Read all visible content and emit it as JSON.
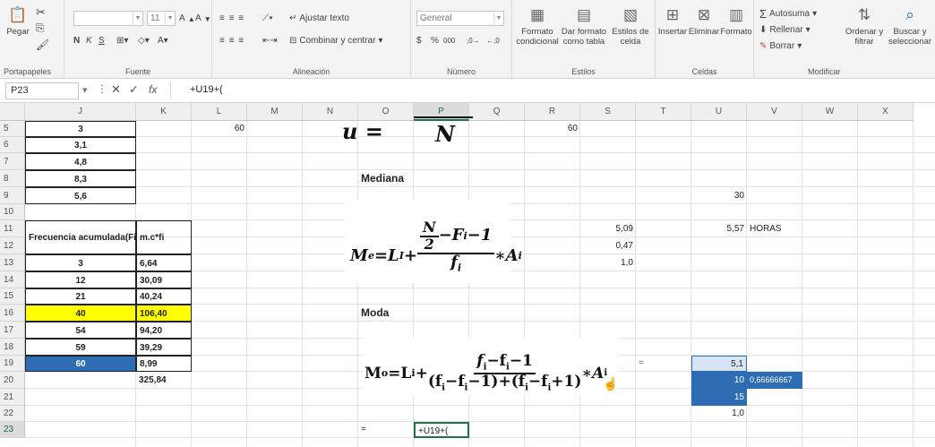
{
  "ribbon": {
    "clipboard": {
      "paste": "Pegar",
      "label": "Portapapeles"
    },
    "font": {
      "size": "11",
      "bold": "N",
      "italic": "K",
      "underline": "S",
      "label": "Fuente"
    },
    "alignment": {
      "wrap": "Ajustar texto",
      "merge": "Combinar y centrar",
      "label": "Alineación"
    },
    "number": {
      "format": "General",
      "currency": "$",
      "percent": "%",
      "thousands": "000",
      "label": "Número"
    },
    "styles": {
      "conditional_1": "Formato",
      "conditional_2": "condicional",
      "table_1": "Dar formato",
      "table_2": "como tabla",
      "cell_styles_1": "Estilos de",
      "cell_styles_2": "celda",
      "label": "Estilos"
    },
    "cells": {
      "insert": "Insertar",
      "delete": "Eliminar",
      "format": "Formato",
      "label": "Celdas"
    },
    "editing": {
      "autosum": "Autosuma",
      "fill": "Rellenar",
      "clear": "Borrar",
      "sort_1": "Ordenar y",
      "sort_2": "filtrar",
      "find_1": "Buscar y",
      "find_2": "seleccionar",
      "label": "Modificar"
    }
  },
  "formula_bar": {
    "name_box": "P23",
    "fx": "fx",
    "content": "+U19+("
  },
  "columns": [
    "J",
    "K",
    "L",
    "M",
    "N",
    "O",
    "P",
    "Q",
    "R",
    "S",
    "T",
    "U",
    "V",
    "W",
    "X"
  ],
  "rows": [
    "5",
    "6",
    "7",
    "8",
    "9",
    "10",
    "11",
    "12",
    "13",
    "14",
    "15",
    "16",
    "17",
    "18",
    "19",
    "20",
    "21",
    "22",
    "23"
  ],
  "cells": {
    "J5": "3",
    "J6": "3,1",
    "J7": "4,8",
    "J8": "8,3",
    "J9": "5,6",
    "J11": "Frecuencia acumulada(Fi)",
    "K11": "m.c*fi",
    "J13": "3",
    "K13": "6,64",
    "J14": "12",
    "K14": "30,09",
    "J15": "21",
    "K15": "40,24",
    "J16": "40",
    "K16": "106,40",
    "J17": "54",
    "K17": "94,20",
    "J18": "59",
    "K18": "39,29",
    "J19": "60",
    "K19": "8,99",
    "K20": "325,84",
    "L5": "60",
    "R5": "60",
    "O8": "Mediana",
    "O16": "Moda",
    "U9": "30",
    "S11": "5,09",
    "U11": "5,57",
    "V11": "HORAS",
    "S12": "0,47",
    "S13": "1,0",
    "T19": "=",
    "U19": "5,1",
    "U20": "10",
    "V20": "0,66666667",
    "U21": "15",
    "U22": "1,0",
    "O23": "=",
    "P23": "+U19+("
  },
  "formulas": {
    "mean_lhs": "u =",
    "mean_den": "N",
    "median_lhs": "M",
    "median_sub": "e",
    "median_eq": "=L",
    "median_lsub": "I",
    "median_plus": "+",
    "median_n": "N",
    "median_two": "2",
    "median_minus": "−F",
    "median_fi": "i",
    "median_m1": "−1",
    "median_den": "f",
    "median_den_sub": "i",
    "median_times": "∗A",
    "median_ai": "i",
    "mode_lhs": "M",
    "mode_sub": "o",
    "mode_eq": "=L",
    "mode_isub": "i",
    "mode_plus": "+",
    "mode_num": "f",
    "mode_num_i": "i",
    "mode_num_rest": "−f",
    "mode_num_i2": "i",
    "mode_num_end": "−1",
    "mode_den": "(f",
    "mode_den_1": "i",
    "mode_den_2": "−f",
    "mode_den_3": "i",
    "mode_den_4": "−1)+(f",
    "mode_den_5": "i",
    "mode_den_6": "−f",
    "mode_den_7": "i",
    "mode_den_8": "+1)",
    "mode_times": "∗A",
    "mode_ai": "i"
  }
}
